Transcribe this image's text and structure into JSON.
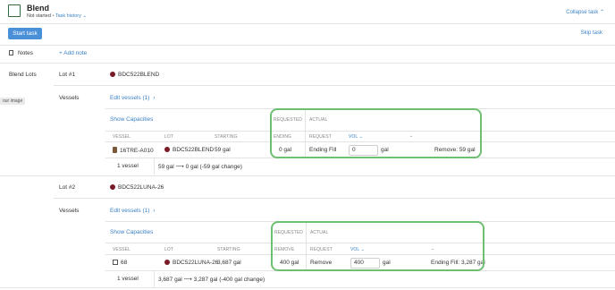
{
  "header": {
    "title": "Blend",
    "status": "Not started",
    "separator": "•",
    "task_history": "Task history",
    "task_history_caret": "⌄",
    "collapse": "Collapse task",
    "collapse_caret": "⌃",
    "start": "Start task",
    "skip": "Skip task"
  },
  "notes": {
    "label": "Notes",
    "add": "+ Add note"
  },
  "tooltip": "our image",
  "section_label": "Blend Lots",
  "lots": [
    {
      "lot_label": "Lot #1",
      "lot_name": "BDC522BLEND",
      "vessels_label": "Vessels",
      "edit": "Edit vessels (1)",
      "edit_arrow": "›",
      "show_cap": "Show Capacities",
      "requested": "REQUESTED",
      "actual": "ACTUAL",
      "cols": {
        "vessel": "VESSEL",
        "lot": "LOT",
        "starting": "STARTING",
        "req_col": "ENDING",
        "request": "REQUEST",
        "vol": "VOL",
        "vol_caret": "⌄",
        "caret2": "⌄"
      },
      "row": {
        "vessel": "16TRE-A010",
        "lot": "BDC522BLEND",
        "starting": "59 gal",
        "req_val": "0 gal",
        "request": "Ending Fill",
        "input": "0",
        "unit": "gal",
        "result": "Remove: 59 gal"
      },
      "footer": {
        "count": "1 vessel",
        "summary": "59 gal ⟶ 0 gal (-59 gal change)"
      }
    },
    {
      "lot_label": "Lot #2",
      "lot_name": "BDC522LUNA-26",
      "vessels_label": "Vessels",
      "edit": "Edit vessels (1)",
      "edit_arrow": "›",
      "show_cap": "Show Capacities",
      "requested": "REQUESTED",
      "actual": "ACTUAL",
      "cols": {
        "vessel": "VESSEL",
        "lot": "LOT",
        "starting": "STARTING",
        "req_col": "REMOVE",
        "request": "REQUEST",
        "vol": "VOL",
        "vol_caret": "⌄",
        "caret2": "⌄"
      },
      "row": {
        "vessel": "68",
        "lot": "BDC522LUNA-26",
        "starting": "3,687 gal",
        "req_val": "400 gal",
        "request": "Remove",
        "input": "400",
        "unit": "gal",
        "result": "Ending Fill: 3,287 gal"
      },
      "footer": {
        "count": "1 vessel",
        "summary": "3,687 gal ⟶ 3,287 gal (-400 gal change)"
      }
    }
  ]
}
